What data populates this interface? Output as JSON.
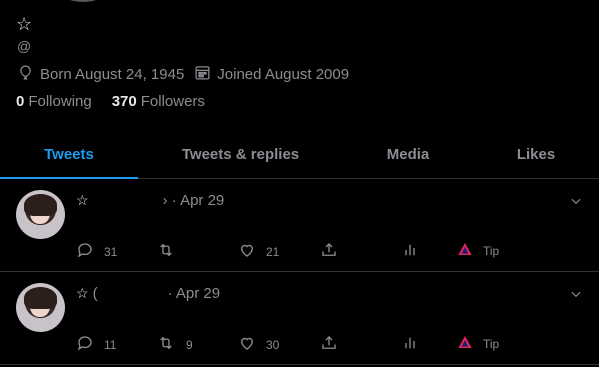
{
  "profile": {
    "name": "☆",
    "handle": "@",
    "born": "Born August 24, 1945",
    "joined": "Joined August 2009",
    "following_count": "0",
    "following_label": "Following",
    "followers_count": "370",
    "followers_label": "Followers"
  },
  "tabs": [
    {
      "label": "Tweets",
      "active": true
    },
    {
      "label": "Tweets & replies",
      "active": false
    },
    {
      "label": "Media",
      "active": false
    },
    {
      "label": "Likes",
      "active": false
    }
  ],
  "tweets": [
    {
      "star": "☆",
      "name_fragment": "›",
      "date": "· Apr 29",
      "replies": "31",
      "retweets": "",
      "likes": "21",
      "tip": "Tip"
    },
    {
      "star": "☆",
      "name_fragment": "(",
      "date": "· Apr 29",
      "replies": "11",
      "retweets": "9",
      "likes": "30",
      "tip": "Tip"
    }
  ],
  "colors": {
    "accent": "#1d9bf0",
    "muted": "#8a8d91",
    "tip_icon": "#e0245e"
  }
}
